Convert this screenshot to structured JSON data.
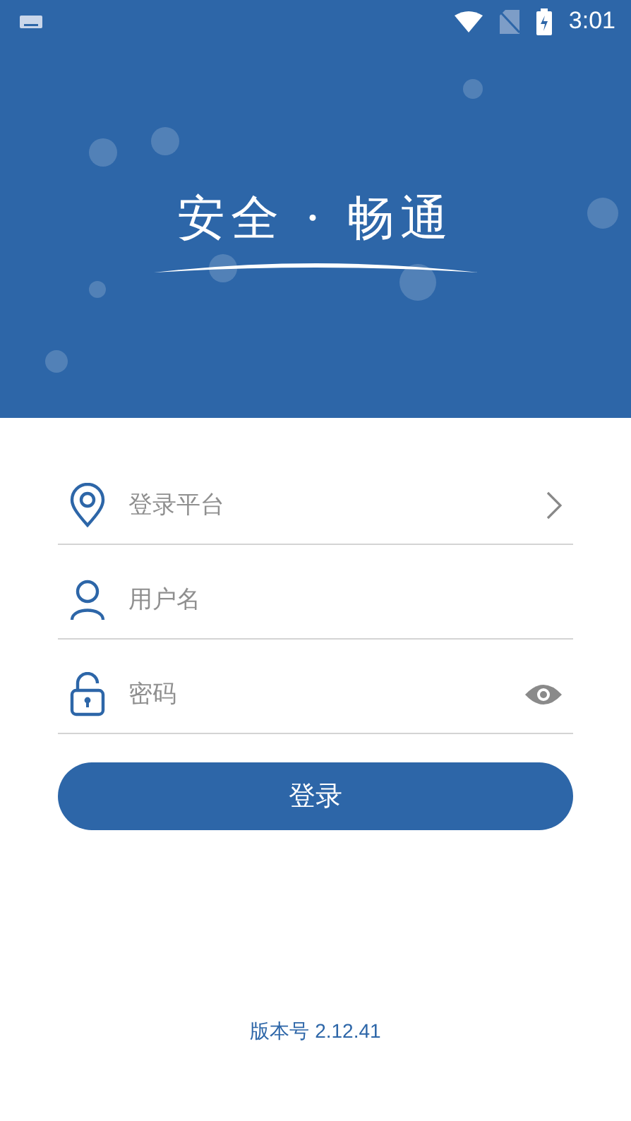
{
  "status_bar": {
    "time": "3:01"
  },
  "banner": {
    "title": "安全 · 畅通"
  },
  "fields": [
    {
      "kind": "select",
      "placeholder": "登录平台"
    },
    {
      "kind": "text",
      "placeholder": "用户名"
    },
    {
      "kind": "password",
      "placeholder": "密码"
    }
  ],
  "login_button": "登录",
  "version": "版本号 2.12.41"
}
